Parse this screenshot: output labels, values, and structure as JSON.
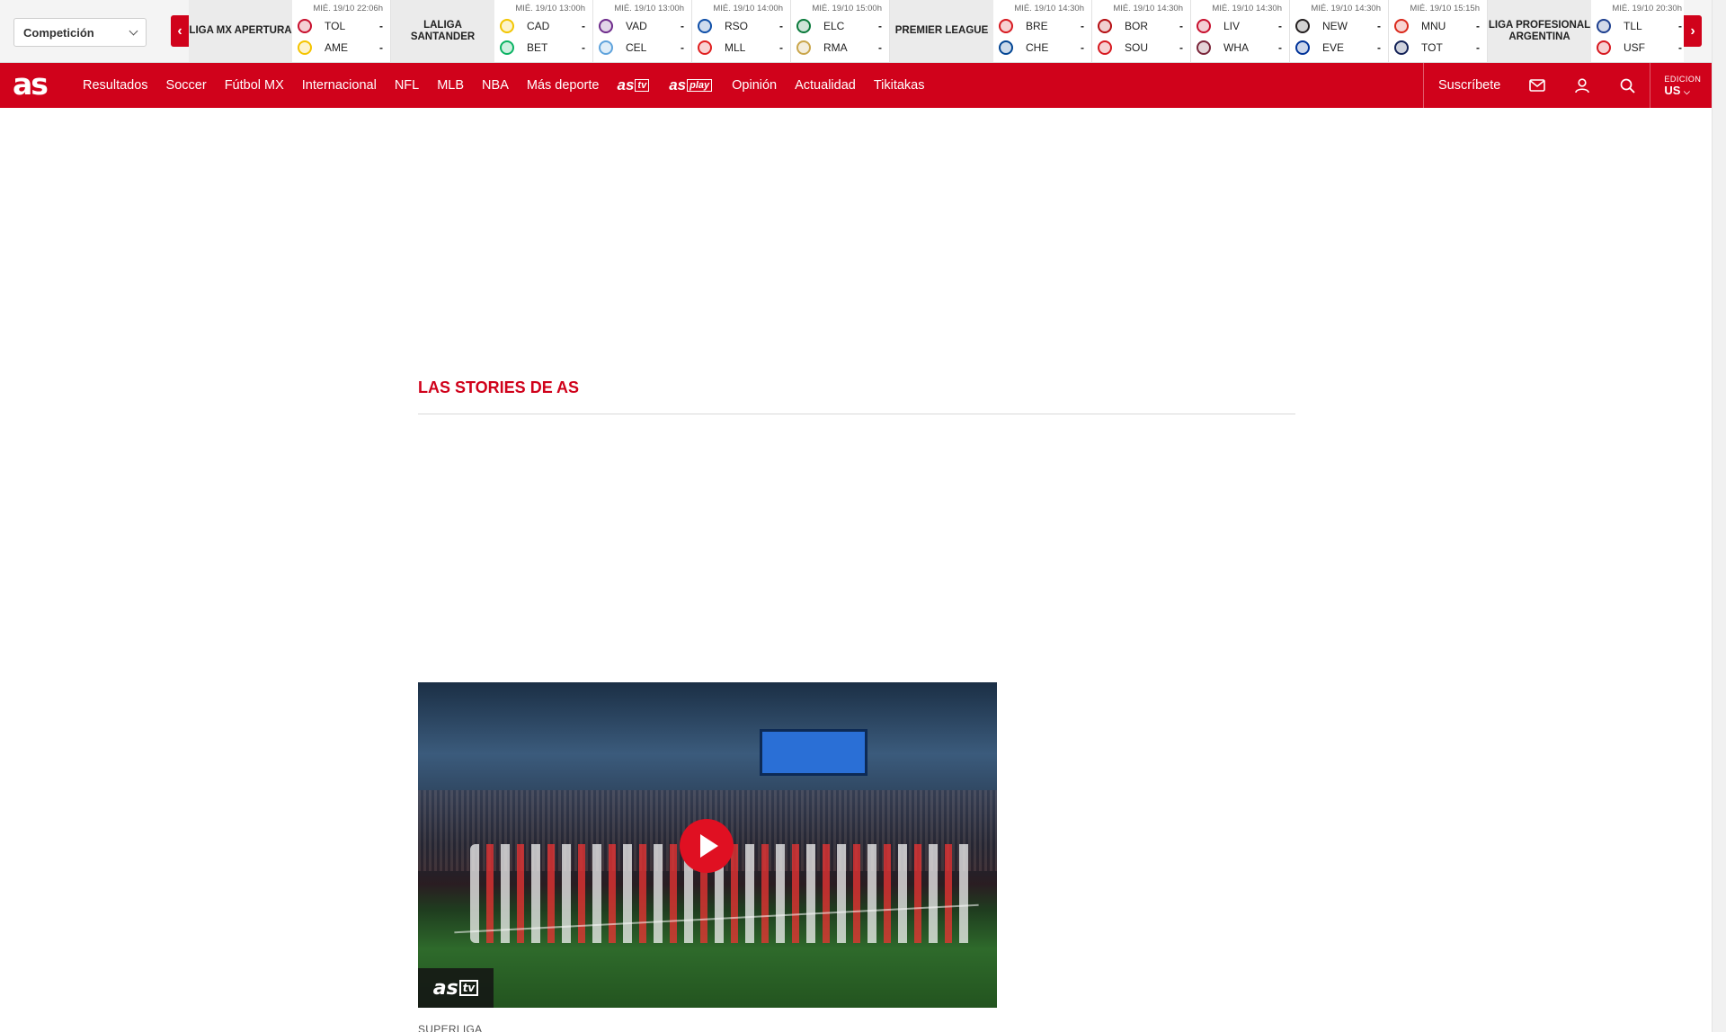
{
  "scores_bar": {
    "competition_label": "Competición",
    "groups": [
      {
        "league": "Liga MX Apertura",
        "matches": [
          {
            "date": "MIÉ. 19/10 22:06h",
            "home": "TOL",
            "away": "AME",
            "home_score": "-",
            "away_score": "-",
            "home_color": "#c8102e",
            "away_color": "#f5c400"
          }
        ]
      },
      {
        "league": "LaLiga Santander",
        "matches": [
          {
            "date": "MIÉ. 19/10 13:00h",
            "home": "CAD",
            "away": "BET",
            "home_score": "-",
            "away_score": "-",
            "home_color": "#f2c500",
            "away_color": "#0bb363"
          },
          {
            "date": "MIÉ. 19/10 13:00h",
            "home": "VAD",
            "away": "CEL",
            "home_score": "-",
            "away_score": "-",
            "home_color": "#6e2b8b",
            "away_color": "#5fa3dc"
          },
          {
            "date": "MIÉ. 19/10 14:00h",
            "home": "RSO",
            "away": "MLL",
            "home_score": "-",
            "away_score": "-",
            "home_color": "#0f4fa8",
            "away_color": "#e02020"
          },
          {
            "date": "MIÉ. 19/10 15:00h",
            "home": "ELC",
            "away": "RMA",
            "home_score": "-",
            "away_score": "-",
            "home_color": "#0a7a3b",
            "away_color": "#caa64b"
          }
        ]
      },
      {
        "league": "Premier League",
        "matches": [
          {
            "date": "MIÉ. 19/10 14:30h",
            "home": "BRE",
            "away": "CHE",
            "home_score": "-",
            "away_score": "-",
            "home_color": "#d71920",
            "away_color": "#034694"
          },
          {
            "date": "MIÉ. 19/10 14:30h",
            "home": "BOR",
            "away": "SOU",
            "home_score": "-",
            "away_score": "-",
            "home_color": "#b50e12",
            "away_color": "#d71920"
          },
          {
            "date": "MIÉ. 19/10 14:30h",
            "home": "LIV",
            "away": "WHA",
            "home_score": "-",
            "away_score": "-",
            "home_color": "#c8102e",
            "away_color": "#7a263a"
          },
          {
            "date": "MIÉ. 19/10 14:30h",
            "home": "NEW",
            "away": "EVE",
            "home_score": "-",
            "away_score": "-",
            "home_color": "#241f20",
            "away_color": "#003399"
          },
          {
            "date": "MIÉ. 19/10 15:15h",
            "home": "MNU",
            "away": "TOT",
            "home_score": "-",
            "away_score": "-",
            "home_color": "#da291c",
            "away_color": "#132257"
          }
        ]
      },
      {
        "league": "Liga Profesional Argentina",
        "matches": [
          {
            "date": "MIÉ. 19/10 20:30h",
            "home": "TLL",
            "away": "USF",
            "home_score": "-",
            "away_score": "-",
            "home_color": "#1d3f8f",
            "away_color": "#d71920"
          }
        ]
      }
    ]
  },
  "nav": {
    "logo": "as",
    "items": [
      "Resultados",
      "Soccer",
      "Fútbol MX",
      "Internacional",
      "NFL",
      "MLB",
      "NBA",
      "Más deporte"
    ],
    "astv": {
      "text": "as",
      "box": "tv"
    },
    "asplay": {
      "text": "as",
      "box": "play"
    },
    "items2": [
      "Opinión",
      "Actualidad",
      "Tikitakas"
    ],
    "subscribe": "Suscríbete",
    "edition_label": "EDICION",
    "edition_value": "US"
  },
  "main": {
    "stories_title": "LAS STORIES DE AS",
    "video_badge": {
      "text": "as",
      "box": "tv"
    },
    "video_caption": "SUPERLIGA"
  },
  "colors": {
    "brand_red": "#d0021b",
    "play_red": "#e01022"
  }
}
